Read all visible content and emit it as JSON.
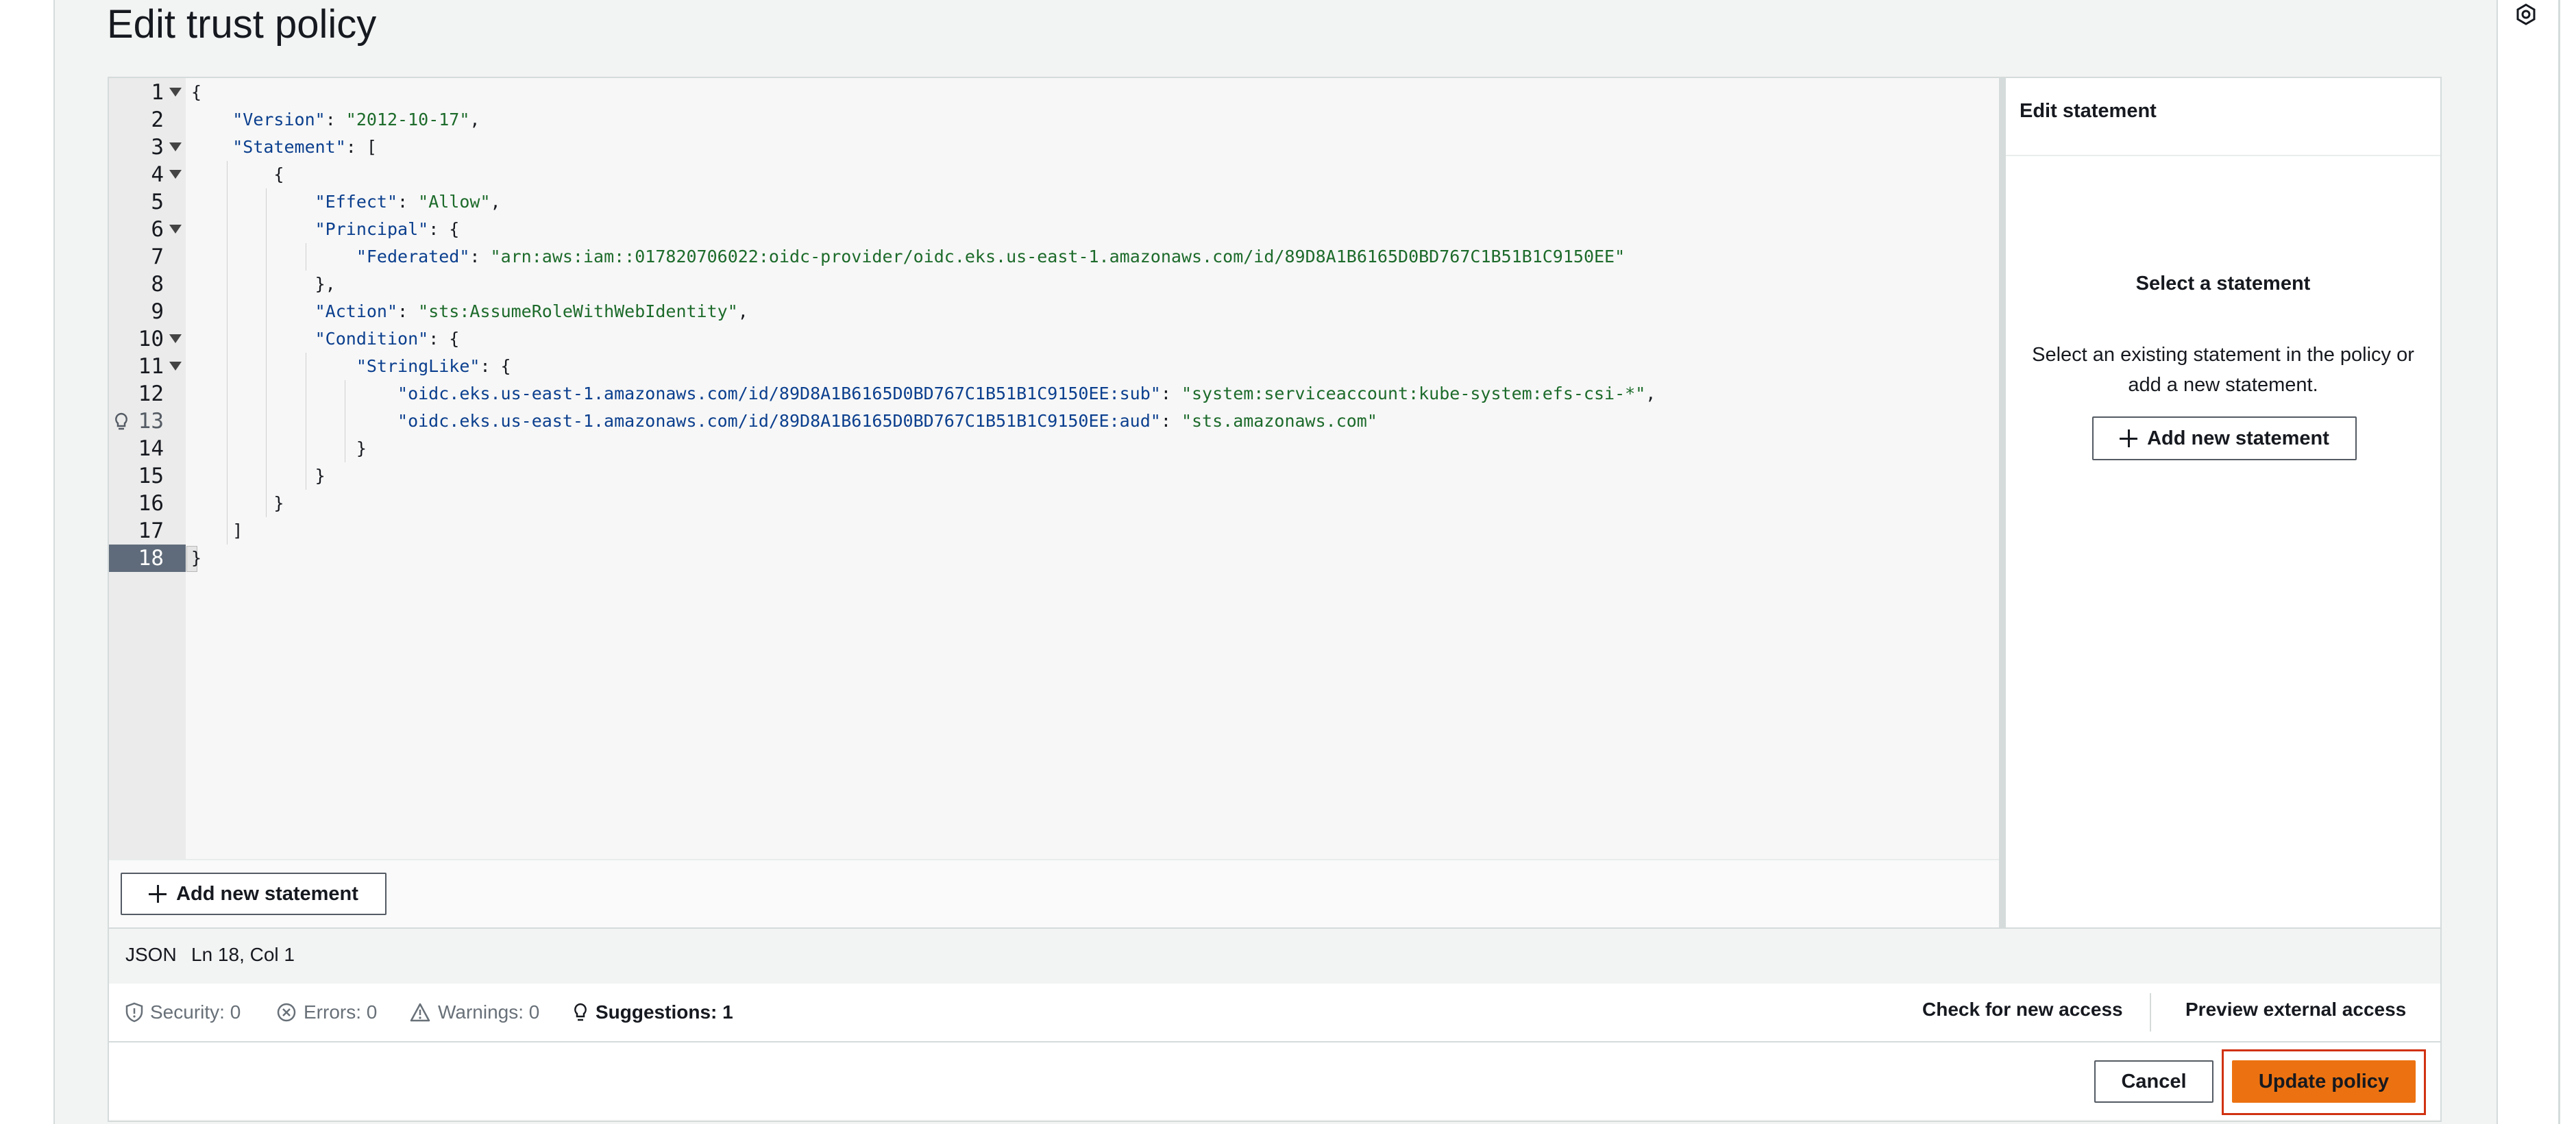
{
  "page": {
    "title": "Edit trust policy"
  },
  "editor": {
    "lines": [
      {
        "n": "1",
        "fold": true
      },
      {
        "n": "2",
        "fold": false
      },
      {
        "n": "3",
        "fold": true
      },
      {
        "n": "4",
        "fold": true
      },
      {
        "n": "5",
        "fold": false
      },
      {
        "n": "6",
        "fold": true
      },
      {
        "n": "7",
        "fold": false
      },
      {
        "n": "8",
        "fold": false
      },
      {
        "n": "9",
        "fold": false
      },
      {
        "n": "10",
        "fold": true
      },
      {
        "n": "11",
        "fold": true
      },
      {
        "n": "12",
        "fold": false
      },
      {
        "n": "13",
        "fold": false,
        "hint": true
      },
      {
        "n": "14",
        "fold": false
      },
      {
        "n": "15",
        "fold": false
      },
      {
        "n": "16",
        "fold": false
      },
      {
        "n": "17",
        "fold": false
      },
      {
        "n": "18",
        "fold": false,
        "active": true
      }
    ],
    "code": {
      "l1": {
        "t": "{"
      },
      "l2": {
        "k": "\"Version\"",
        "c": ": ",
        "v": "\"2012-10-17\"",
        "e": ","
      },
      "l3": {
        "k": "\"Statement\"",
        "c": ": ["
      },
      "l4": {
        "t": "{"
      },
      "l5": {
        "k": "\"Effect\"",
        "c": ": ",
        "v": "\"Allow\"",
        "e": ","
      },
      "l6": {
        "k": "\"Principal\"",
        "c": ": {"
      },
      "l7": {
        "k": "\"Federated\"",
        "c": ": ",
        "v": "\"arn:aws:iam::017820706022:oidc-provider/oidc.eks.us-east-1.amazonaws.com/id/89D8A1B6165D0BD767C1B51B1C9150EE\""
      },
      "l8": {
        "t": "},"
      },
      "l9": {
        "k": "\"Action\"",
        "c": ": ",
        "v": "\"sts:AssumeRoleWithWebIdentity\"",
        "e": ","
      },
      "l10": {
        "k": "\"Condition\"",
        "c": ": {"
      },
      "l11": {
        "k": "\"StringLike\"",
        "c": ": {"
      },
      "l12": {
        "k": "\"oidc.eks.us-east-1.amazonaws.com/id/89D8A1B6165D0BD767C1B51B1C9150EE:sub\"",
        "c": ": ",
        "v": "\"system:serviceaccount:kube-system:efs-csi-*\"",
        "e": ","
      },
      "l13": {
        "k": "\"oidc.eks.us-east-1.amazonaws.com/id/89D8A1B6165D0BD767C1B51B1C9150EE:aud\"",
        "c": ": ",
        "v": "\"sts.amazonaws.com\""
      },
      "l14": {
        "t": "}"
      },
      "l15": {
        "t": "}"
      },
      "l16": {
        "t": "}"
      },
      "l17": {
        "t": "]"
      },
      "l18": {
        "t": "}"
      }
    },
    "add_statement_label": "Add new statement"
  },
  "side_panel": {
    "header": "Edit statement",
    "empty_title": "Select a statement",
    "empty_description": "Select an existing statement in the policy or add a new statement.",
    "add_statement_label": "Add new statement"
  },
  "status": {
    "language": "JSON",
    "position": "Ln 18, Col 1"
  },
  "validation": {
    "security": "Security: 0",
    "errors": "Errors: 0",
    "warnings": "Warnings: 0",
    "suggestions": "Suggestions: 1",
    "check_access": "Check for new access",
    "preview_access": "Preview external access"
  },
  "footer": {
    "cancel": "Cancel",
    "update": "Update policy"
  },
  "colors": {
    "accent": "#ec7211",
    "highlight": "#d13212",
    "json_key": "#0b3f8e",
    "json_string": "#1d6b2b"
  },
  "icons": [
    "plus-icon",
    "shield-icon",
    "error-icon",
    "warning-icon",
    "lightbulb-icon",
    "settings-icon",
    "fold-arrow-icon"
  ]
}
